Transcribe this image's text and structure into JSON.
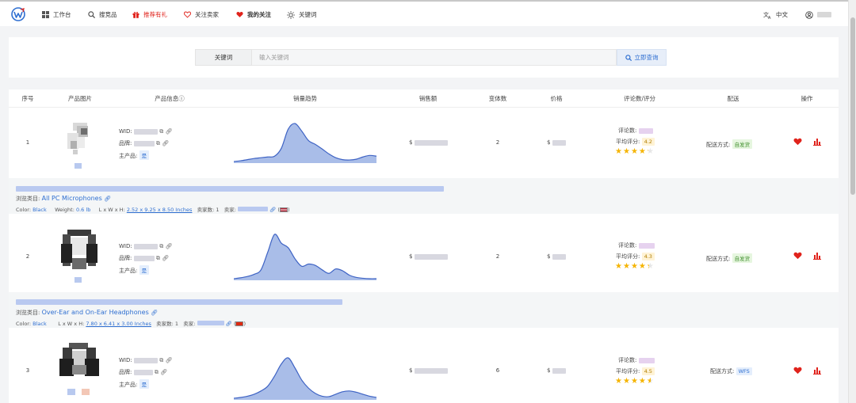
{
  "nav": {
    "items": [
      {
        "label": "工作台",
        "icon": "grid-icon"
      },
      {
        "label": "搜竞品",
        "icon": "search-icon"
      },
      {
        "label": "推荐有礼",
        "icon": "gift-icon"
      },
      {
        "label": "关注卖家",
        "icon": "heart-outline-icon"
      },
      {
        "label": "我的关注",
        "icon": "heart-filled-icon"
      },
      {
        "label": "关键词",
        "icon": "sun-icon"
      }
    ],
    "language": "中文"
  },
  "search": {
    "label": "关键词",
    "placeholder": "输入关键词",
    "button": "立即查询"
  },
  "table": {
    "headers": [
      "序号",
      "产品图片",
      "产品信息ⓘ",
      "销量趋势",
      "销售额",
      "变体数",
      "价格",
      "评论数/评分",
      "配送",
      "操作"
    ],
    "rows": [
      {
        "index": "1",
        "wid_label": "WID:",
        "brand_label": "品牌:",
        "main_label": "主产品:",
        "main_value": "是",
        "sales_prefix": "$",
        "variants": "2",
        "price_prefix": "$",
        "reviews_label": "评论数:",
        "rating_label": "平均评分:",
        "rating": "4.2",
        "rating_value": 4.2,
        "delivery_label": "配送方式:",
        "delivery": "自发货",
        "category_label": "浏览类目:",
        "category": "All PC Microphones",
        "color_label": "Color:",
        "color": "Black",
        "weight_label": "Weight:",
        "weight": "0.6 lb",
        "dims_label": "L x W x H:",
        "dims": "2.52 x 9.25 x 8.50 Inches",
        "sellers_label": "卖家数:",
        "sellers": "1",
        "seller_label": "卖家:",
        "trend": [
          0.0,
          0.02,
          0.05,
          0.08,
          0.1,
          0.12,
          0.14,
          0.35,
          0.85,
          1.0,
          0.8,
          0.55,
          0.45,
          0.33,
          0.2,
          0.1,
          0.05,
          0.04,
          0.06,
          0.12,
          0.16,
          0.14
        ]
      },
      {
        "index": "2",
        "wid_label": "WID:",
        "brand_label": "品牌:",
        "main_label": "主产品:",
        "main_value": "是",
        "sales_prefix": "$",
        "variants": "2",
        "price_prefix": "$",
        "reviews_label": "评论数:",
        "rating_label": "平均评分:",
        "rating": "4.3",
        "rating_value": 4.3,
        "delivery_label": "配送方式:",
        "delivery": "自发货",
        "category_label": "浏览类目:",
        "category": "Over-Ear and On-Ear Headphones",
        "color_label": "Color:",
        "color": "Black",
        "dims_label": "L x W x H:",
        "dims": "7.80 x 6.41 x 3.00 Inches",
        "sellers_label": "卖家数:",
        "sellers": "1",
        "seller_label": "卖家:",
        "trend": [
          0.0,
          0.02,
          0.05,
          0.1,
          0.2,
          0.6,
          1.0,
          0.8,
          0.7,
          0.45,
          0.28,
          0.33,
          0.3,
          0.2,
          0.12,
          0.22,
          0.18,
          0.08,
          0.03,
          0.01,
          0.0,
          0.0
        ]
      },
      {
        "index": "3",
        "wid_label": "WID:",
        "brand_label": "品牌:",
        "main_label": "主产品:",
        "main_value": "是",
        "sales_prefix": "$",
        "variants": "6",
        "price_prefix": "$",
        "reviews_label": "评论数:",
        "rating_label": "平均评分:",
        "rating": "4.5",
        "rating_value": 4.5,
        "delivery_label": "配送方式:",
        "delivery": "WFS",
        "trend": [
          0.0,
          0.02,
          0.05,
          0.1,
          0.18,
          0.3,
          0.55,
          0.85,
          1.0,
          0.75,
          0.45,
          0.25,
          0.12,
          0.05,
          0.04,
          0.1,
          0.16,
          0.18,
          0.15,
          0.1,
          0.05,
          0.02
        ]
      }
    ]
  },
  "colors": {
    "accent": "#2f6fd1",
    "red": "#e0231c",
    "chart_fill": "#a9bde8",
    "chart_line": "#3e63c4",
    "star": "#f5b400"
  }
}
